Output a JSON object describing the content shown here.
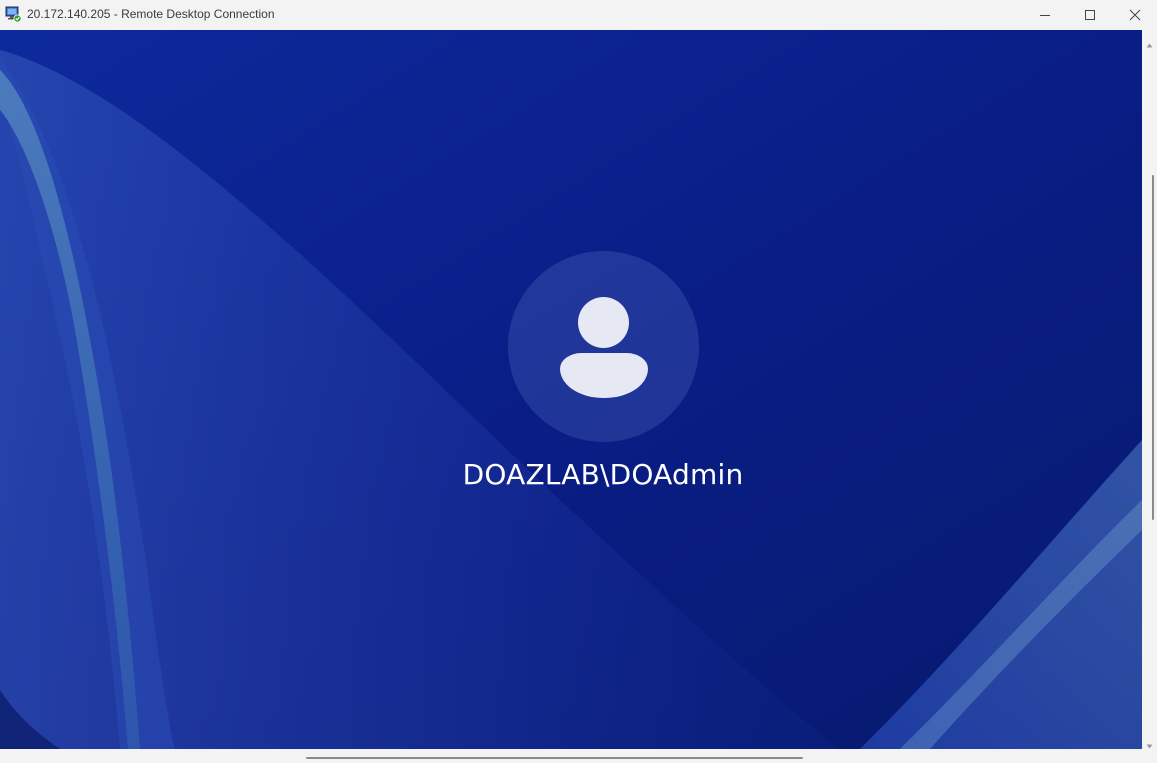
{
  "window": {
    "title": "20.172.140.205 - Remote Desktop Connection",
    "app_icon": "remote-desktop-icon",
    "controls": {
      "minimize_icon": "minimize-icon",
      "maximize_icon": "maximize-icon",
      "close_icon": "close-icon"
    }
  },
  "lock_screen": {
    "avatar_icon": "user-avatar-icon",
    "username": "DOAZLAB\\DOAdmin",
    "background_color": "#0a1f8a"
  },
  "scrollbars": {
    "vertical": {
      "up_icon": "arrow-up-icon",
      "down_icon": "arrow-down-icon"
    },
    "horizontal": {}
  }
}
